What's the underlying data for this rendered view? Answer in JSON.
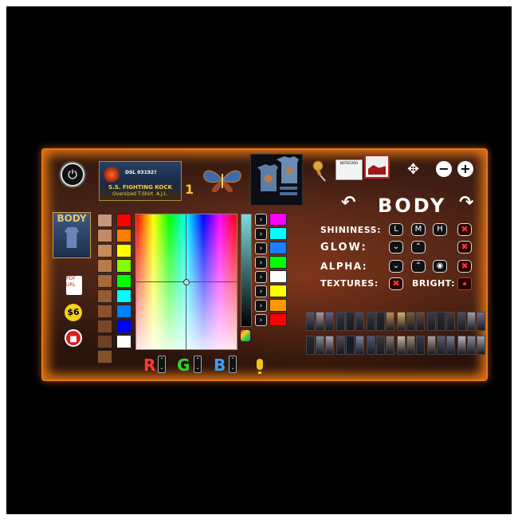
{
  "header": {
    "power_icon": "power-icon",
    "product_brand": "DSL 03192?",
    "product_name": "S.S. FIGHTING KOCK",
    "product_subtitle": "Oversized T-Shirt",
    "product_author": "A.J.L.",
    "counter": "1",
    "notecard_label": "NOTECARD",
    "move_icon": "move-icon",
    "minus_label": "−",
    "plus_label": "+"
  },
  "section": {
    "title": "BODY",
    "prev_icon": "arrow-left-icon",
    "next_icon": "arrow-right-icon"
  },
  "sidebar": {
    "body_label": "BODY",
    "pdf_label": "PDF URL",
    "badge_label": "$6",
    "red_icon": "red-square-icon"
  },
  "colors": {
    "skin_swatches": [
      "#c8967c",
      "#c48a66",
      "#c78a5b",
      "#b87b4c",
      "#a56a3c",
      "#955c34",
      "#8a532c",
      "#7a4828",
      "#6e4024",
      "#84522a"
    ],
    "base_swatches": [
      "#ff0000",
      "#ff8000",
      "#ffff00",
      "#80ff00",
      "#00ff00",
      "#00ffff",
      "#0080ff",
      "#0000ff",
      "#ffffff"
    ],
    "presets": [
      "#ff00ff",
      "#00ffff",
      "#1a7fff",
      "#00ff00",
      "#ffffff",
      "#ffff00",
      "#ff9900",
      "#ff0000"
    ],
    "accent": "#e07a18"
  },
  "controls": {
    "shininess_label": "SHININESS:",
    "shininess_buttons": [
      "L",
      "M",
      "H"
    ],
    "glow_label": "GLOW:",
    "alpha_label": "ALPHA:",
    "textures_label": "TEXTURES:",
    "bright_label": "BRIGHT:",
    "down_icon": "chevron-down-icon",
    "up_icon": "chevron-up-icon",
    "eye_icon": "eye-icon",
    "close_icon": "close-icon"
  },
  "rgb": {
    "r": "R",
    "g": "G",
    "b": "B"
  },
  "texture_thumbs_row1": [
    "#5a5466",
    "#a99aa0",
    "#6a5a8a",
    "#3a3a4a",
    "#2a2a3a",
    "#4a4a5a",
    "#3a3a44",
    "#2a2a2a",
    "#c88a4a",
    "#d6b06a",
    "#7a5a3a",
    "#6a4a3a",
    "#3a3a4a",
    "#2a2a3a",
    "#4a3a3a",
    "#4a4a5a",
    "#a0a0a8",
    "#7a6a8a"
  ],
  "texture_thumbs_row2": [
    "#2a2a2a",
    "#8a8a9a",
    "#b0a0b0",
    "#4a4a5a",
    "#1a1a2a",
    "#7a86a6",
    "#4a5a7a",
    "#3a3a3a",
    "#8a7a6a",
    "#c9bba9",
    "#a08a70",
    "#3a3a4a",
    "#b0a090",
    "#5a5a70",
    "#7a7a9a",
    "#c0b0c0",
    "#8a8aa0",
    "#a0a0b0"
  ]
}
